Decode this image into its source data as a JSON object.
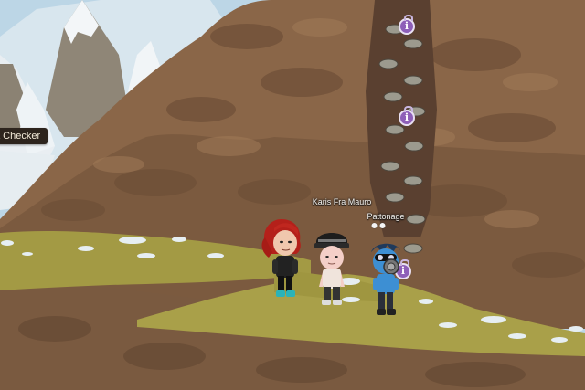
{
  "scene": {
    "location_label": "a Checker",
    "players": [
      {
        "id": "karis",
        "name": "Karis Fra Mauro"
      },
      {
        "id": "pattonage",
        "name": "Pattonage"
      }
    ],
    "info_markers": [
      {
        "id": "info-top",
        "glyph": "i"
      },
      {
        "id": "info-mid",
        "glyph": "i"
      },
      {
        "id": "info-low",
        "glyph": "i"
      }
    ],
    "colors": {
      "sky": "#bcd6e6",
      "rock": "#8a6648",
      "grass": "#a39a44",
      "info_purple": "#8e5fb8"
    }
  }
}
